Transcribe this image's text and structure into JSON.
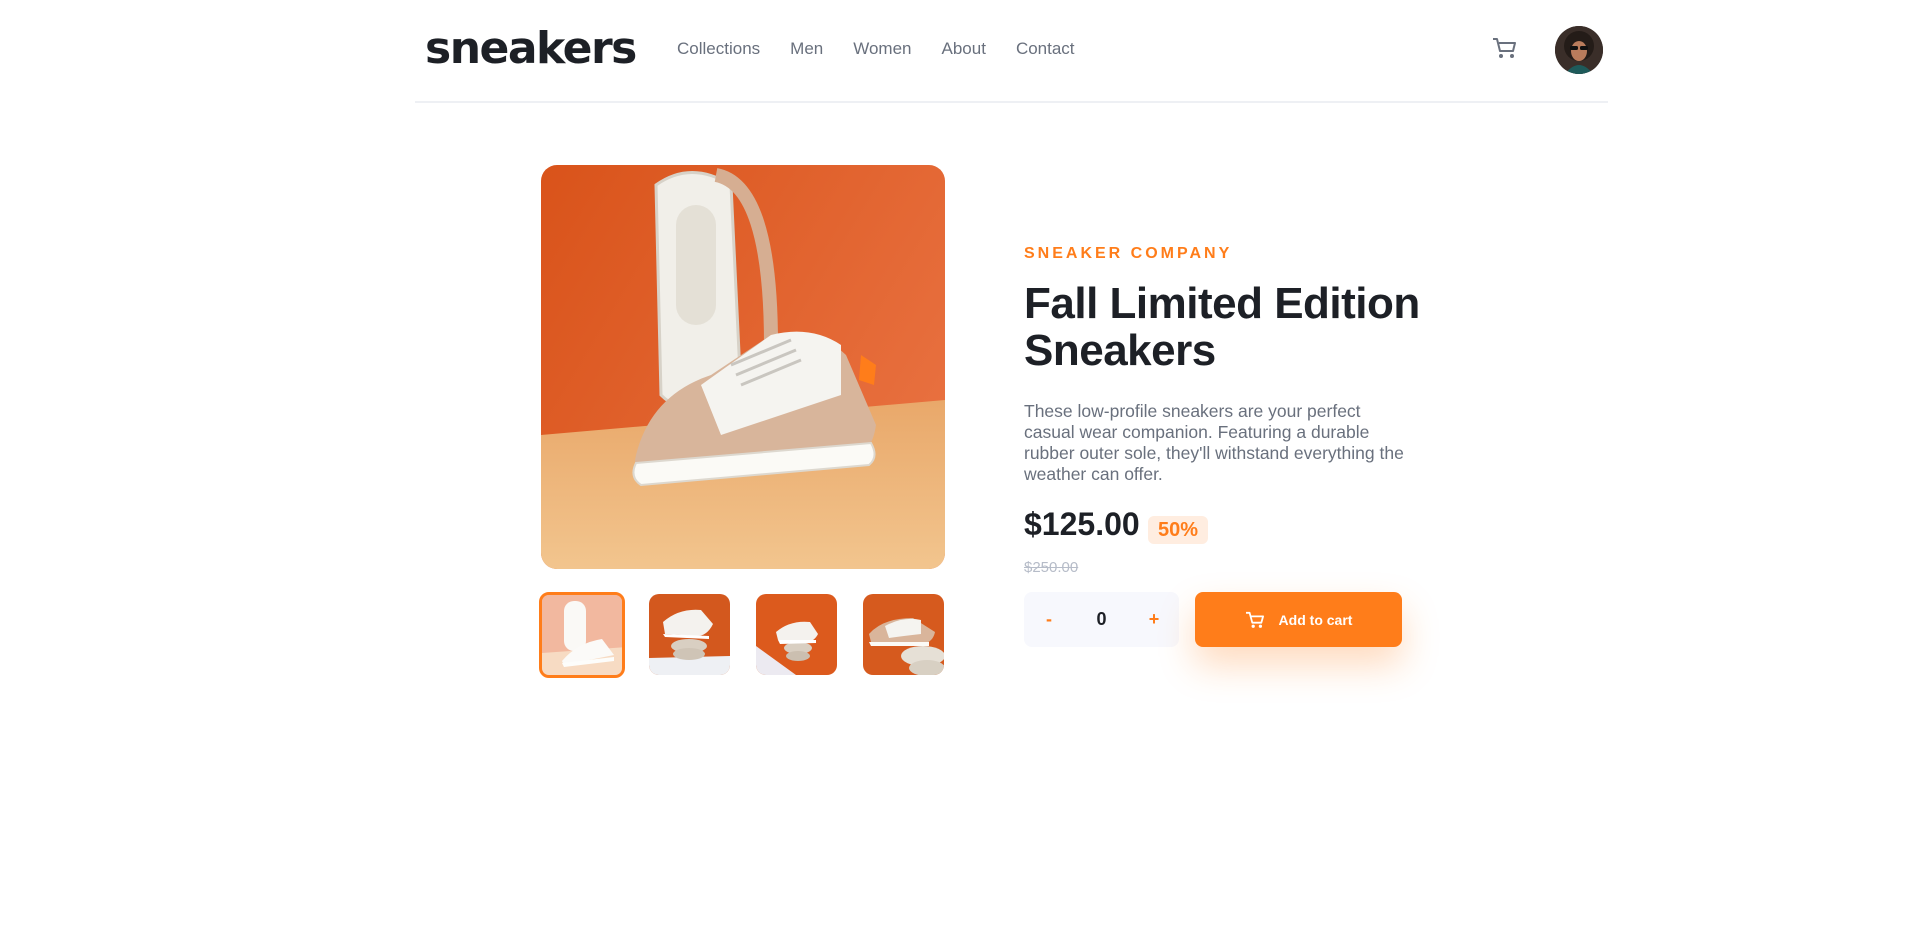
{
  "header": {
    "logo": "sneakers",
    "nav": [
      "Collections",
      "Men",
      "Women",
      "About",
      "Contact"
    ],
    "cart_icon": "cart-icon",
    "avatar_icon": "user-avatar"
  },
  "colors": {
    "accent": "#ff7d1a",
    "accent_pale": "#ffede0",
    "text_dark": "#1d2026",
    "text_gray": "#69707d",
    "text_light": "#b6bcc8",
    "qty_bg": "#f7f8fd"
  },
  "gallery": {
    "main_image": "product-image-1",
    "thumbnails": [
      "product-thumb-1",
      "product-thumb-2",
      "product-thumb-3",
      "product-thumb-4"
    ],
    "active_index": 0
  },
  "product": {
    "company": "SNEAKER COMPANY",
    "title": "Fall Limited Edition Sneakers",
    "description": "These low-profile sneakers are your perfect casual wear companion. Featuring a durable rubber outer sole, they'll withstand everything the weather can offer.",
    "price": "$125.00",
    "discount": "50%",
    "original_price": "$250.00"
  },
  "cart_controls": {
    "minus": "-",
    "quantity": "0",
    "plus": "+",
    "add_label": "Add to cart",
    "add_icon": "cart-icon"
  }
}
